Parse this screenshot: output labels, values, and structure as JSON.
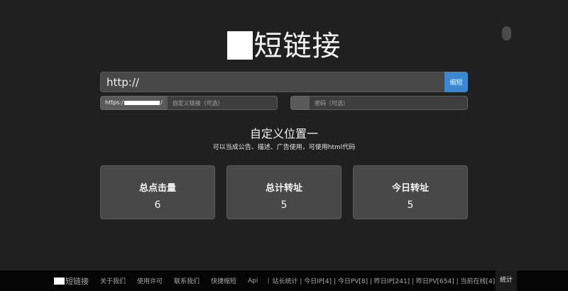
{
  "header": {
    "title": "短链接"
  },
  "form": {
    "url_value": "http://",
    "shorten_label": "缩短",
    "domain_prefix_start": "https:/",
    "domain_prefix_end": "/",
    "custom_placeholder": "自定义链接（可选）",
    "password_placeholder": "密码（可选）"
  },
  "custom_section": {
    "title": "自定义位置一",
    "subtitle": "可以当成公告、描述、广告使用，可使用html代码"
  },
  "stats": [
    {
      "label": "总点击量",
      "value": "6"
    },
    {
      "label": "总计转址",
      "value": "5"
    },
    {
      "label": "今日转址",
      "value": "5"
    }
  ],
  "footer": {
    "brand": "短链接",
    "links": [
      "关于我们",
      "使用许可",
      "联系我们",
      "快捷缩短",
      "Api"
    ],
    "separator": "|",
    "stats_text": "站长统计 | 今日IP[4] | 今日PV[8] | 昨日IP[241] | 昨日PV[654] | 当前在线[4]",
    "stats_button": "统计"
  },
  "colors": {
    "background": "#202020",
    "accent": "#3b87d0",
    "stats_link": "#3fa9f5"
  }
}
